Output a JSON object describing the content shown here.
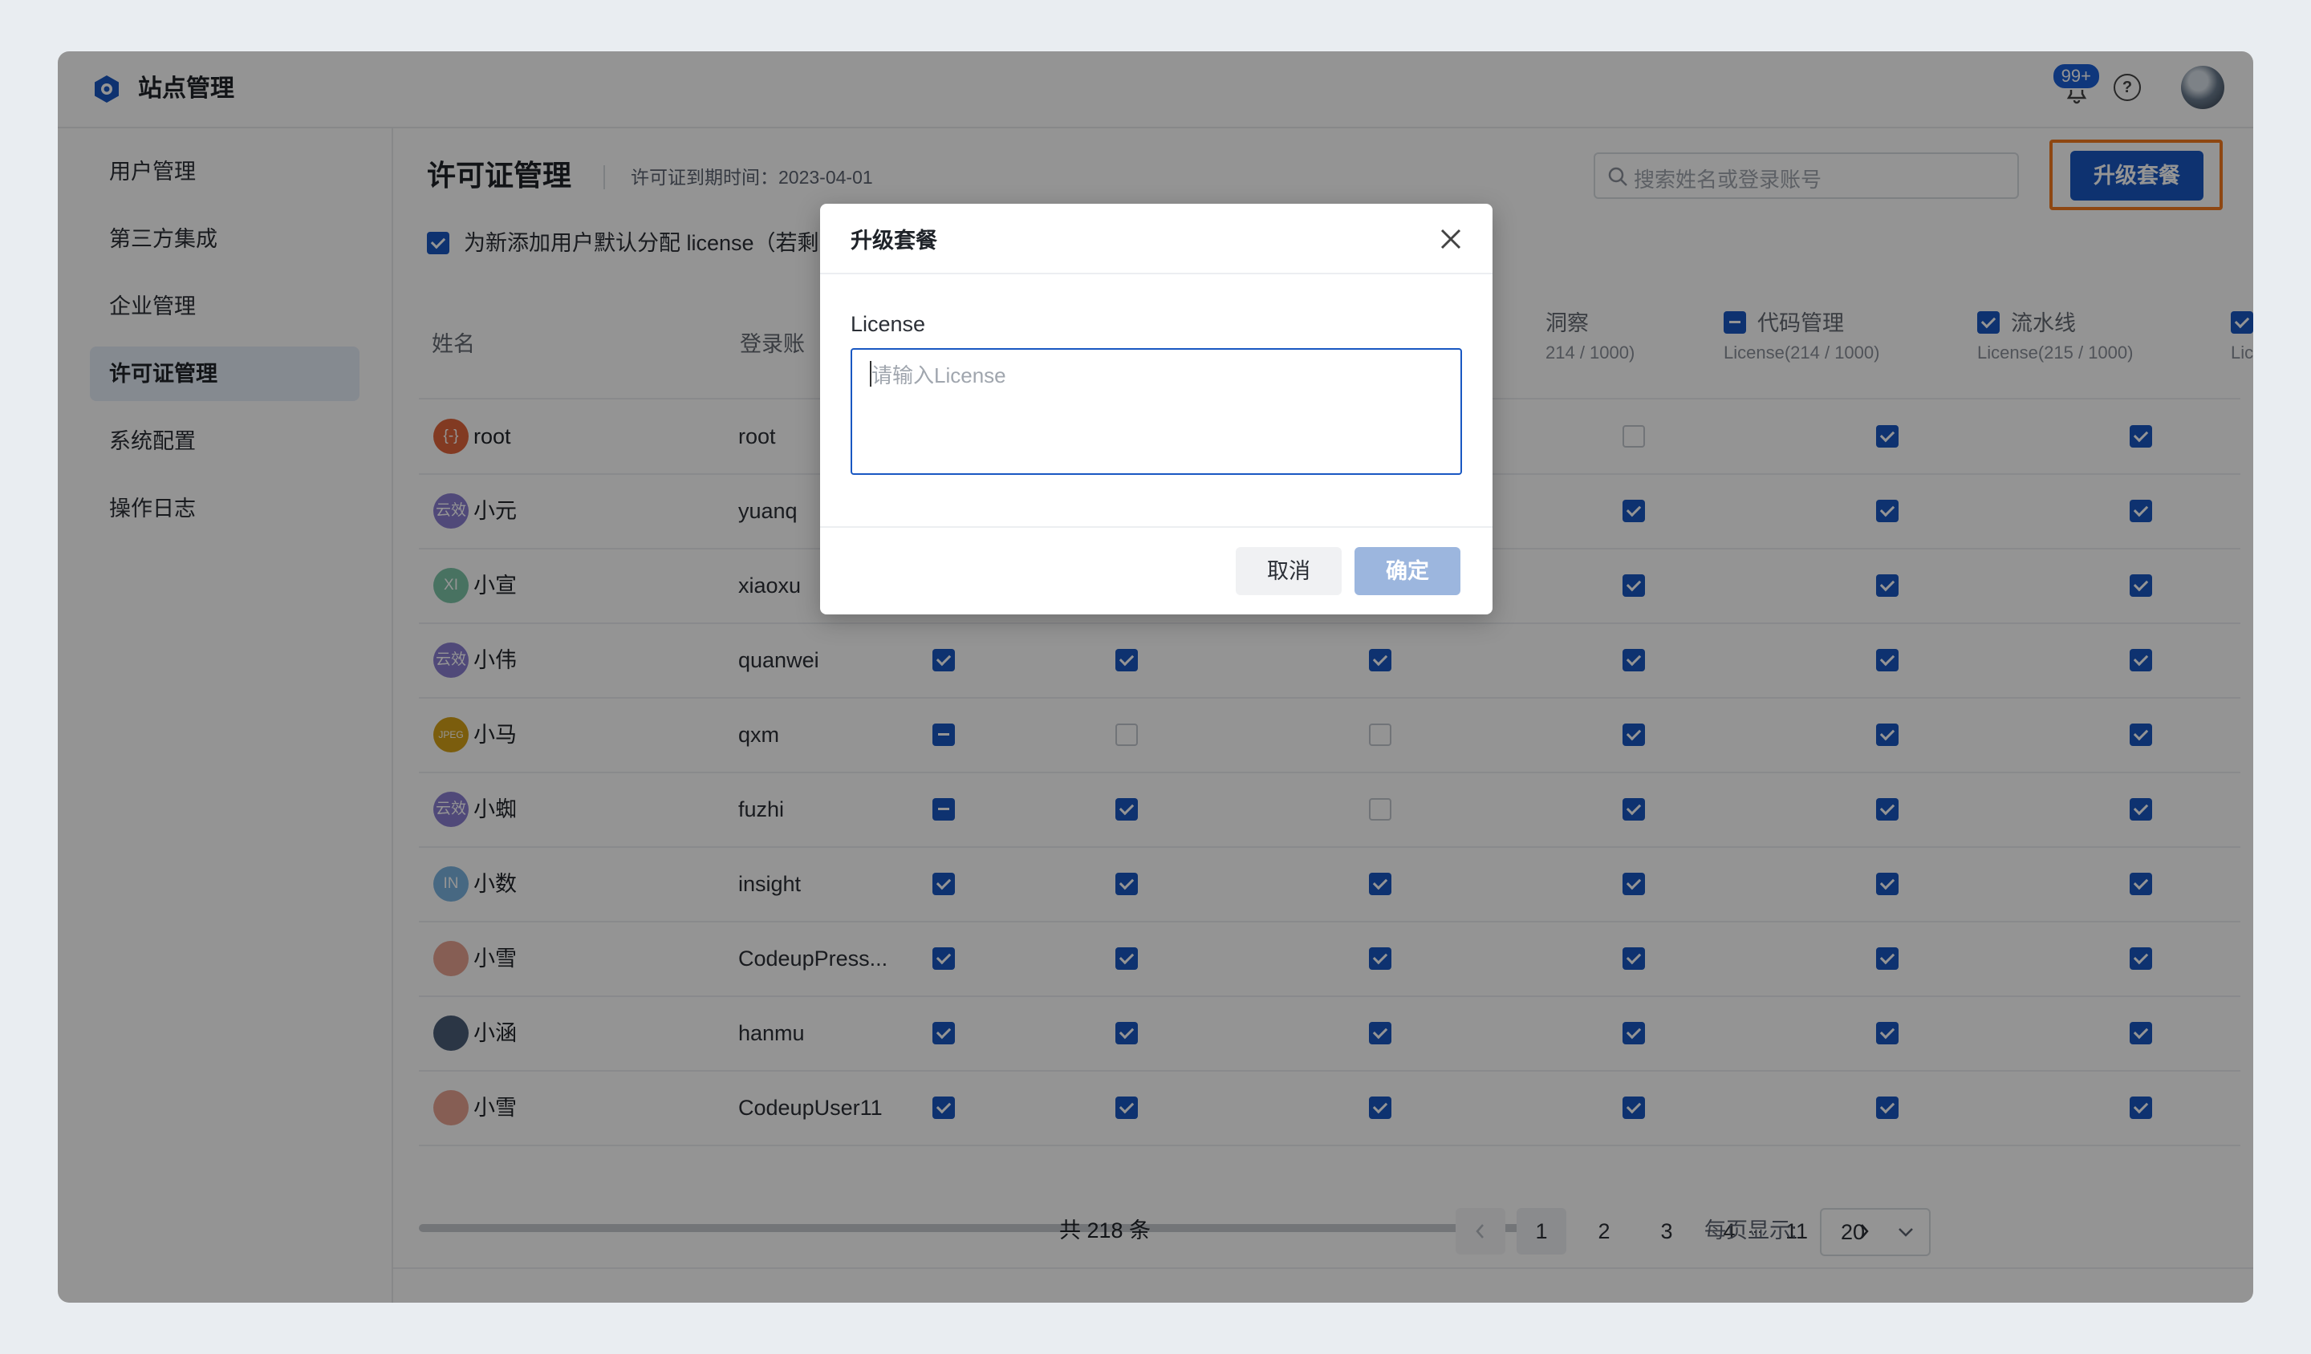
{
  "app": {
    "title": "站点管理",
    "notif_badge": "99+"
  },
  "sidebar": {
    "items": [
      {
        "label": "用户管理"
      },
      {
        "label": "第三方集成"
      },
      {
        "label": "企业管理"
      },
      {
        "label": "许可证管理",
        "active": true
      },
      {
        "label": "系统配置"
      },
      {
        "label": "操作日志"
      }
    ]
  },
  "page": {
    "title": "许可证管理",
    "expire": "许可证到期时间：2023-04-01",
    "search_placeholder": "搜索姓名或登录账号",
    "upgrade_label": "升级套餐",
    "default_assign": "为新添加用户默认分配 license（若剩"
  },
  "table": {
    "columns": [
      {
        "label": "姓名"
      },
      {
        "label": "登录账"
      },
      {
        "label": "洞察",
        "sub": "214 / 1000)",
        "state": "none"
      },
      {
        "label": "代码管理",
        "sub": "License(214 / 1000)",
        "state": "indet"
      },
      {
        "label": "流水线",
        "sub": "License(215 / 1000)",
        "state": "checked"
      },
      {
        "label": "",
        "sub": "Lice",
        "state": "checked"
      }
    ],
    "rows": [
      {
        "name": "root",
        "login": "root",
        "avatar": "{-}",
        "avatar_color": "#e0643c",
        "checks": [
          "",
          "",
          "",
          "empty",
          "checked",
          "checked"
        ]
      },
      {
        "name": "小元",
        "login": "yuanq",
        "avatar": "云效",
        "avatar_color": "#8b7fd1",
        "checks": [
          "",
          "",
          "",
          "checked",
          "checked",
          "checked"
        ]
      },
      {
        "name": "小宣",
        "login": "xiaoxu",
        "avatar": "XI",
        "avatar_color": "#7cc4a8",
        "checks": [
          "",
          "",
          "",
          "checked",
          "checked",
          "checked"
        ]
      },
      {
        "name": "小伟",
        "login": "quanwei",
        "avatar": "云效",
        "avatar_color": "#8b7fd1",
        "checks": [
          "checked",
          "checked",
          "checked",
          "checked",
          "checked",
          "checked"
        ]
      },
      {
        "name": "小马",
        "login": "qxm",
        "avatar": "JPEG",
        "avatar_color": "#d4a017",
        "checks": [
          "indet",
          "empty",
          "empty",
          "checked",
          "checked",
          "checked"
        ]
      },
      {
        "name": "小蜘",
        "login": "fuzhi",
        "avatar": "云效",
        "avatar_color": "#8b7fd1",
        "checks": [
          "indet",
          "checked",
          "empty",
          "checked",
          "checked",
          "checked"
        ]
      },
      {
        "name": "小数",
        "login": "insight",
        "avatar": "IN",
        "avatar_color": "#7ab3e0",
        "checks": [
          "checked",
          "checked",
          "checked",
          "checked",
          "checked",
          "checked"
        ]
      },
      {
        "name": "小雪",
        "login": "CodeupPress...",
        "avatar": "",
        "avatar_color": "#e7a292",
        "checks": [
          "checked",
          "checked",
          "checked",
          "checked",
          "checked",
          "checked"
        ]
      },
      {
        "name": "小涵",
        "login": "hanmu",
        "avatar": "",
        "avatar_color": "#4a5d78",
        "checks": [
          "checked",
          "checked",
          "checked",
          "checked",
          "checked",
          "checked"
        ]
      },
      {
        "name": "小雪",
        "login": "CodeupUser11",
        "avatar": "",
        "avatar_color": "#e7a292",
        "checks": [
          "checked",
          "checked",
          "checked",
          "checked",
          "checked",
          "checked"
        ]
      }
    ]
  },
  "pagination": {
    "total": "共 218 条",
    "pages": [
      "1",
      "2",
      "3",
      "4",
      "···",
      "11"
    ],
    "current": "1",
    "per_page_label": "每页显示:",
    "per_page": "20"
  },
  "modal": {
    "title": "升级套餐",
    "field_label": "License",
    "placeholder": "请输入License",
    "cancel": "取消",
    "ok": "确定"
  }
}
